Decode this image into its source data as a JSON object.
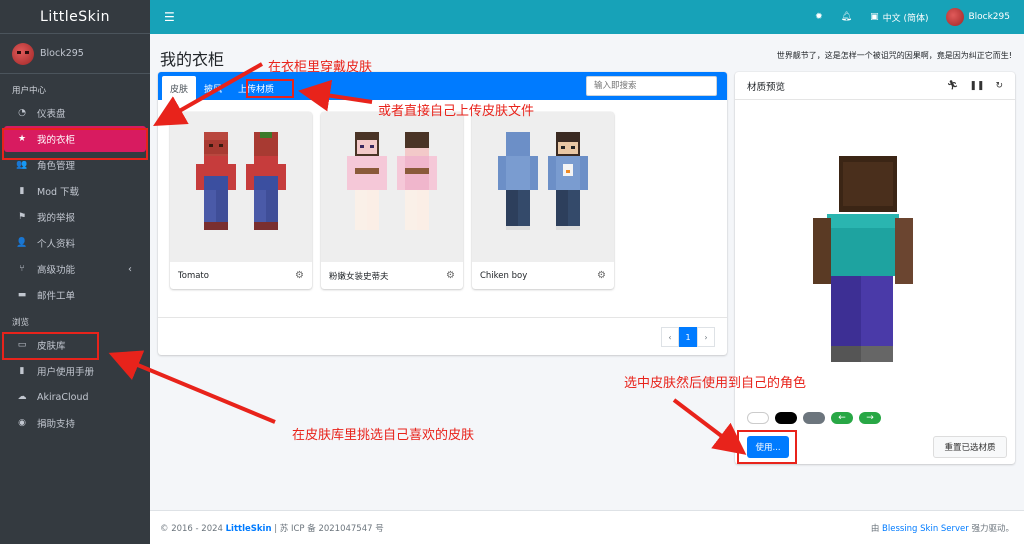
{
  "brand": "LittleSkin",
  "user": {
    "name": "Block295"
  },
  "sidebar": {
    "section_user": "用户中心",
    "section_browse": "浏览",
    "items": [
      {
        "label": "仪表盘",
        "icon": "dashboard-icon"
      },
      {
        "label": "我的衣柜",
        "icon": "star-icon",
        "active": true
      },
      {
        "label": "角色管理",
        "icon": "users-icon"
      },
      {
        "label": "Mod 下载",
        "icon": "book-icon"
      },
      {
        "label": "我的举报",
        "icon": "flag-icon"
      },
      {
        "label": "个人资料",
        "icon": "user-icon"
      },
      {
        "label": "高级功能",
        "icon": "branch-icon"
      },
      {
        "label": "邮件工单",
        "icon": "ticket-icon"
      },
      {
        "label": "皮肤库",
        "icon": "archive-icon"
      },
      {
        "label": "用户使用手册",
        "icon": "book-icon"
      },
      {
        "label": "AkiraCloud",
        "icon": "cloud-icon"
      },
      {
        "label": "捐助支持",
        "icon": "donate-icon"
      }
    ]
  },
  "topbar": {
    "language": "中文 (简体)"
  },
  "page": {
    "title": "我的衣柜",
    "motto": "世界靓节了，这是怎样一个被诅咒的因果啊，竟是因为纠正它而生!"
  },
  "wardrobe": {
    "tabs": [
      "皮肤",
      "披风",
      "上传材质"
    ],
    "search_placeholder": "输入即搜索",
    "skins": [
      {
        "name": "Tomato"
      },
      {
        "name": "粉嫩女装史蒂夫"
      },
      {
        "name": "Chiken boy"
      }
    ],
    "pagination": {
      "prev": "‹",
      "current": "1",
      "next": "›"
    }
  },
  "preview": {
    "title": "材质预览",
    "use_button": "使用...",
    "reset_button": "重置已选材质",
    "swatch_colors": [
      "#ffffff",
      "#000000",
      "#6c757d",
      "#28a745",
      "#28a745"
    ]
  },
  "footer": {
    "copyright_prefix": "© 2016 - 2024",
    "site": "LittleSkin",
    "icp": " | 苏 ICP 备 2021047547 号",
    "powered_prefix": "由 ",
    "powered_link": "Blessing Skin Server",
    "powered_suffix": " 强力驱动。"
  },
  "annotations": {
    "wear_skin": "在衣柜里穿戴皮肤",
    "upload_skin": "或者直接自己上传皮肤文件",
    "choose_skin": "在皮肤库里挑选自己喜欢的皮肤",
    "apply_skin": "选中皮肤然后使用到自己的角色"
  },
  "colors": {
    "sidebar_bg": "#343a40",
    "topbar_bg": "#17a2b8",
    "active_item": "#d81b60",
    "primary": "#007bff",
    "annotation_red": "#e8231b"
  }
}
